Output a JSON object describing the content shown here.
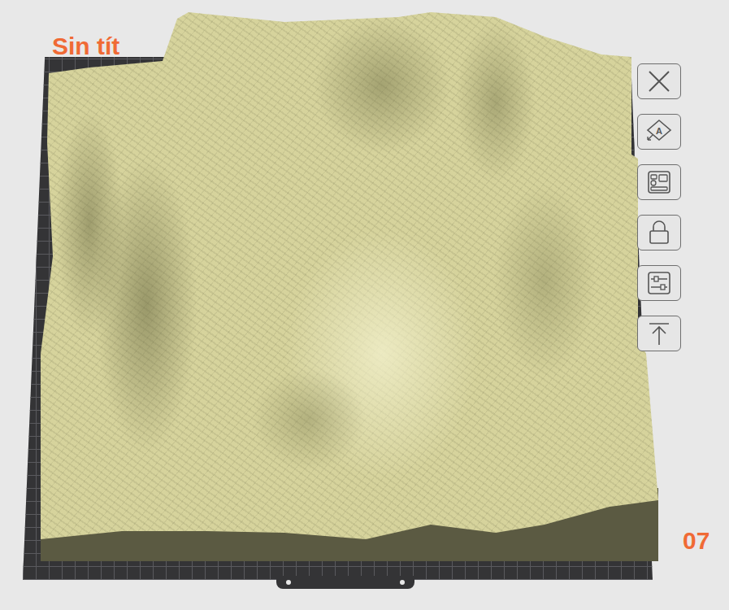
{
  "plate": {
    "title": "Sin tít",
    "number": "07"
  },
  "toolbar": [
    {
      "kind": "close"
    },
    {
      "kind": "auto-orient",
      "label": "A"
    },
    {
      "kind": "arrange"
    },
    {
      "kind": "lock"
    },
    {
      "kind": "settings"
    },
    {
      "kind": "to-top"
    }
  ]
}
